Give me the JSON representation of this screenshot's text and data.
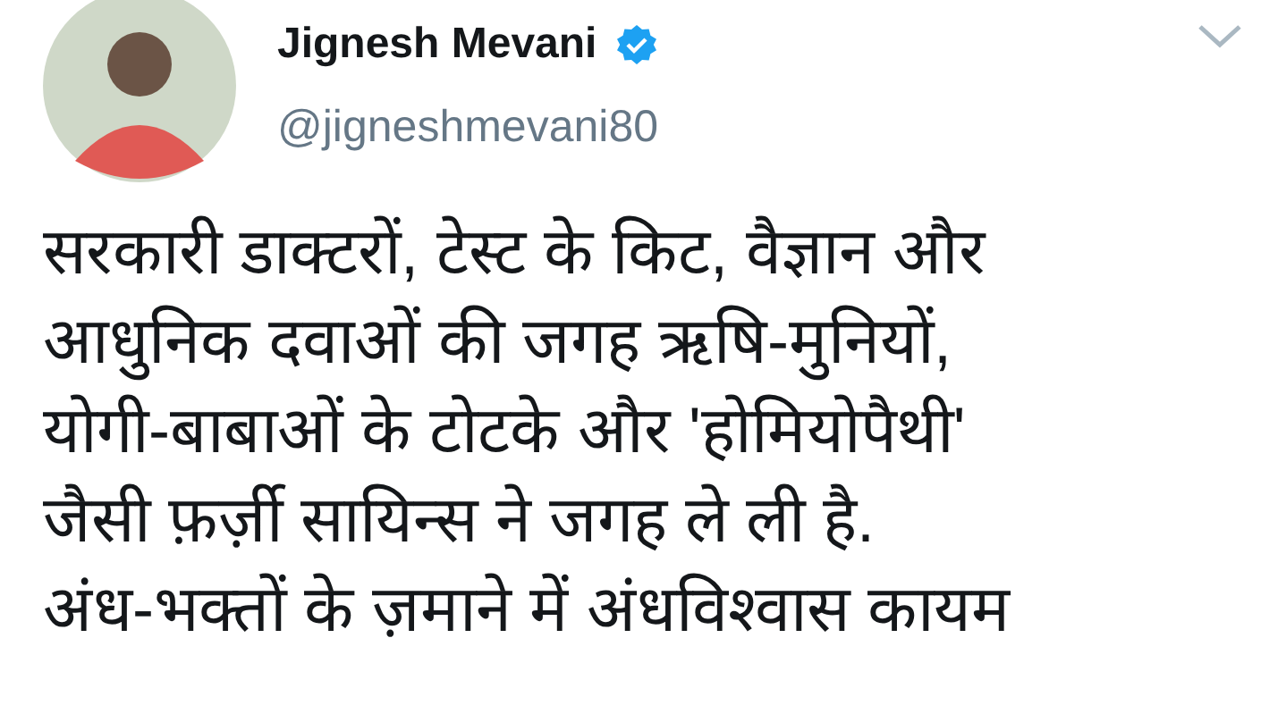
{
  "tweet": {
    "author": {
      "name": "Jignesh Mevani",
      "verified": true,
      "handle": "@jigneshmevani80"
    },
    "lines": [
      "सरकारी डाक्टरों, टेस्ट के किट, वैज्ञान और",
      "आधुनिक दवाओं की जगह ऋषि-मुनियों,",
      "योगी-बाबाओं के टोटके और 'होमियोपैथी'",
      "जैसी फ़र्ज़ी सायिन्स ने जगह ले ली है.",
      "अंध-भक्तों के ज़माने में अंधविश्वास कायम"
    ]
  }
}
